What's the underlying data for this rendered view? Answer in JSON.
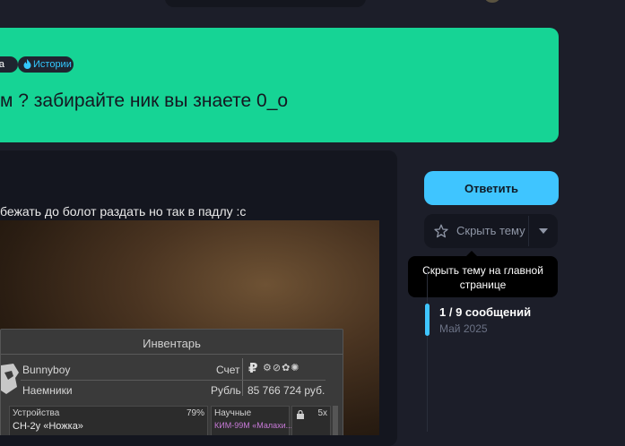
{
  "thread": {
    "tags": [
      {
        "label": "та",
        "color": "#ffffff"
      },
      {
        "label": "Истории",
        "color": "#33c8ff",
        "icon": "flame-icon"
      }
    ],
    "title": "м ? забирайте ник вы знаете 0_о",
    "banner_color": "#16d495"
  },
  "post": {
    "text": "бежать до болот раздать но так в падлу :с",
    "screenshot": {
      "inventory_title": "Инвентарь",
      "player_name": "Bunnyboy",
      "faction": "Наемники",
      "score_label": "Счет",
      "currency_label": "Рубль",
      "money": "85 766 724 руб.",
      "currency_symbol": "₽",
      "badge_icons": "⚙⊘✿✺",
      "slots": [
        {
          "label": "Устройства",
          "percent": "79%",
          "item": "СН-2у «Ножка»"
        },
        {
          "label": "Научные",
          "item": "КИМ-99М «Малахи..."
        },
        {
          "count": "5х"
        }
      ]
    }
  },
  "sidebar": {
    "reply_button": "Ответить",
    "hide_button": "Скрыть тему",
    "tooltip_line1": "Скрыть тему на главной",
    "tooltip_line2": "странице",
    "progress_count": "1 / 9 сообщений",
    "progress_date": "Май 2025",
    "accent_color": "#3fc5ff"
  }
}
